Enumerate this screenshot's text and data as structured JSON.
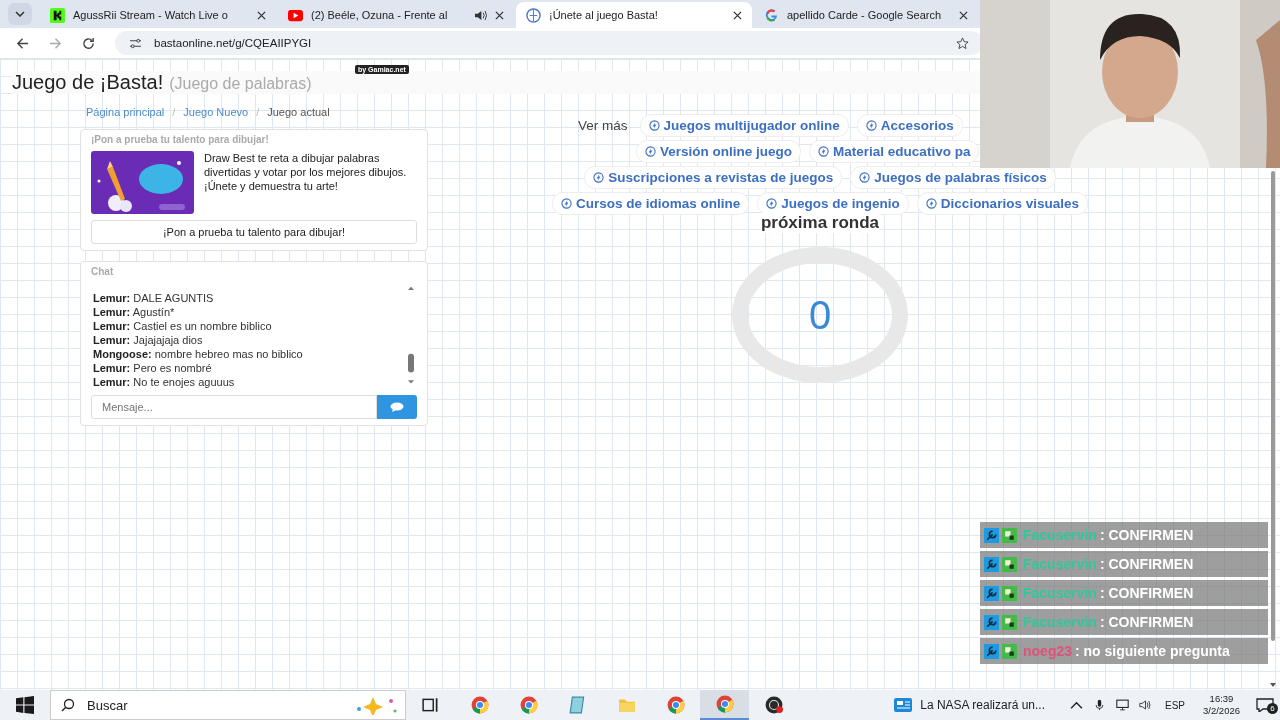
{
  "browser": {
    "tabs": [
      {
        "title": "AgussRii Stream - Watch Live o",
        "kind": "kick",
        "audio": false,
        "selected": false
      },
      {
        "title": "(2) Beéle, Ozuna - Frente al",
        "kind": "youtube",
        "audio": true,
        "selected": false
      },
      {
        "title": "¡Únete al juego Basta!",
        "kind": "site",
        "audio": false,
        "selected": true
      },
      {
        "title": "apellido Carde - Google Search",
        "kind": "google",
        "audio": false,
        "selected": false
      }
    ],
    "url": "bastaonline.net/g/CQEAIIPYGI"
  },
  "page": {
    "badge": "by Gamiac.net",
    "title": "Juego de ¡Basta!",
    "subtitle": "(Juego de palabras)",
    "breadcrumbs": [
      {
        "label": "Página principal",
        "current": false
      },
      {
        "separator": "/",
        "label": "Juego Nuevo",
        "current": false
      },
      {
        "separator": "/",
        "label": "Juego actual",
        "current": true
      }
    ]
  },
  "promo": {
    "heading": "¡Pon a prueba tu talento para dibujar!",
    "text": "Draw Best te reta a dibujar palabras divertidas y votar por los mejores dibujos. ¡Únete y demuestra tu arte!",
    "button": "¡Pon a prueba tu talento para dibujar!"
  },
  "chat": {
    "title": "Chat",
    "messages": [
      {
        "user": "Lemur:",
        "text": "DALE AGUNTIS"
      },
      {
        "user": "Lemur:",
        "text": "Agustín*"
      },
      {
        "user": "Lemur:",
        "text": "Castiel es un nombre biblico"
      },
      {
        "user": "Lemur:",
        "text": "Jajajajaja dios"
      },
      {
        "user": "Mongoose:",
        "text": "nombre hebreo mas no biblico"
      },
      {
        "user": "Lemur:",
        "text": "Pero es nombré"
      },
      {
        "user": "Lemur:",
        "text": "No te enojes aguuus"
      }
    ],
    "placeholder": "Mensaje..."
  },
  "links": {
    "label": "Ver más",
    "rows": [
      [
        "Juegos multijugador online",
        "Accesorios"
      ],
      [
        "Versión online juego",
        "Material educativo pa"
      ],
      [
        "Suscripciones a revistas de juegos",
        "Juegos de palabras físicos"
      ],
      [
        "Cursos de idiomas online",
        "Juegos de ingenio",
        "Diccionarios visuales"
      ]
    ]
  },
  "round": {
    "title": "próxima ronda",
    "count": "0"
  },
  "stream_chat": [
    {
      "user": "Facuservin",
      "color": "#2fc89a",
      "message": ": CONFIRMEN"
    },
    {
      "user": "Facuservin",
      "color": "#2fc89a",
      "message": ": CONFIRMEN"
    },
    {
      "user": "Facuservin",
      "color": "#2fc89a",
      "message": ": CONFIRMEN"
    },
    {
      "user": "Facuservin",
      "color": "#2fc89a",
      "message": ": CONFIRMEN"
    },
    {
      "user": "noeg23",
      "color": "#e0527a",
      "message": ": no siguiente pregunta"
    }
  ],
  "taskbar": {
    "search": "Buscar",
    "apps": [
      {
        "kind": "taskview",
        "active": false
      },
      {
        "kind": "chrome",
        "active": false
      },
      {
        "kind": "chrome",
        "active": false
      },
      {
        "kind": "notes",
        "active": false
      },
      {
        "kind": "folder",
        "active": false
      },
      {
        "kind": "chrome",
        "active": false
      },
      {
        "kind": "chrome",
        "active": true
      },
      {
        "kind": "obs",
        "active": false
      }
    ],
    "news": "La NASA realizará un...",
    "language": "ESP",
    "time": "16:39",
    "date": "3/2/2026",
    "notifications": "6"
  }
}
